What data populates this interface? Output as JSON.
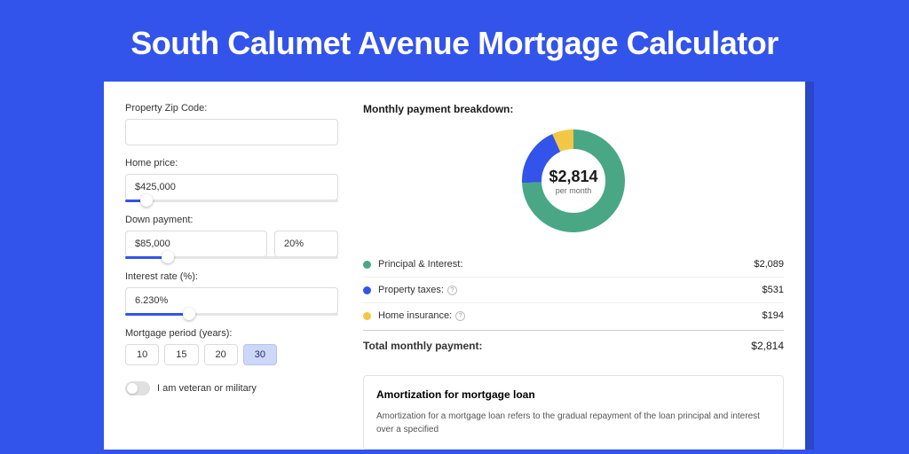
{
  "title": "South Calumet Avenue Mortgage Calculator",
  "form": {
    "zip_label": "Property Zip Code:",
    "zip_value": "",
    "home_price_label": "Home price:",
    "home_price_value": "$425,000",
    "home_price_slider_pct": 10,
    "down_payment_label": "Down payment:",
    "down_payment_value": "$85,000",
    "down_payment_pct_value": "20%",
    "down_payment_slider_pct": 20,
    "interest_label": "Interest rate (%):",
    "interest_value": "6.230%",
    "interest_slider_pct": 30,
    "period_label": "Mortgage period (years):",
    "periods": [
      "10",
      "15",
      "20",
      "30"
    ],
    "period_selected": "30",
    "veteran_label": "I am veteran or military"
  },
  "breakdown": {
    "heading": "Monthly payment breakdown:",
    "center_value": "$2,814",
    "center_label": "per month",
    "items": [
      {
        "label": "Principal & Interest:",
        "amount": "$2,089",
        "color": "#4aa785",
        "info": false
      },
      {
        "label": "Property taxes:",
        "amount": "$531",
        "color": "#3254ea",
        "info": true
      },
      {
        "label": "Home insurance:",
        "amount": "$194",
        "color": "#f2c744",
        "info": true
      }
    ],
    "total_label": "Total monthly payment:",
    "total_amount": "$2,814"
  },
  "chart_data": {
    "type": "pie",
    "title": "Monthly payment breakdown",
    "series": [
      {
        "name": "Principal & Interest",
        "value": 2089,
        "color": "#4aa785"
      },
      {
        "name": "Property taxes",
        "value": 531,
        "color": "#3254ea"
      },
      {
        "name": "Home insurance",
        "value": 194,
        "color": "#f2c744"
      }
    ],
    "total": 2814
  },
  "amort": {
    "heading": "Amortization for mortgage loan",
    "text": "Amortization for a mortgage loan refers to the gradual repayment of the loan principal and interest over a specified"
  }
}
